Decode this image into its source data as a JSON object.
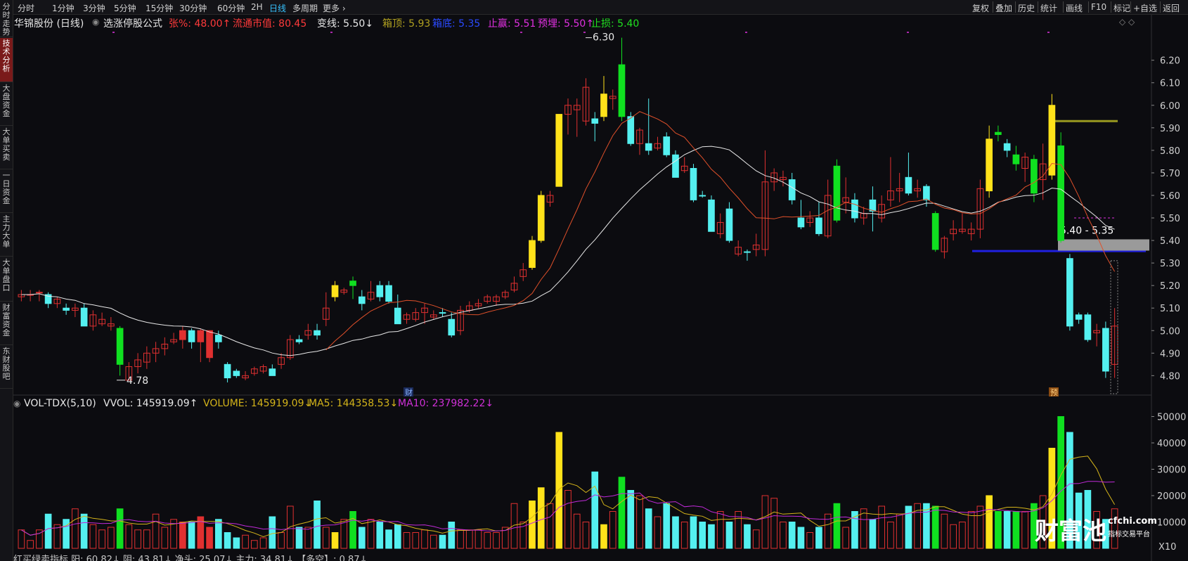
{
  "sidebar": [
    {
      "label": "分时走势",
      "active": false
    },
    {
      "label": "技术分析",
      "active": true
    },
    {
      "label": "大盘资金",
      "active": false
    },
    {
      "label": "大单买卖",
      "active": false
    },
    {
      "label": "一日资金",
      "active": false
    },
    {
      "label": "主力大单",
      "active": false
    },
    {
      "label": "大单盘口",
      "active": false
    },
    {
      "label": "财富资金",
      "active": false
    },
    {
      "label": "东财股吧",
      "active": false
    }
  ],
  "periods": [
    "分时",
    "1分钟",
    "3分钟",
    "5分钟",
    "15分钟",
    "30分钟",
    "60分钟",
    "2H",
    "日线",
    "多周期",
    "更多 ›"
  ],
  "active_period": "日线",
  "tools": [
    "复权",
    "叠加",
    "历史",
    "统计",
    "画线",
    "F10",
    "标记",
    "+自选",
    "返回"
  ],
  "header": {
    "stock": "华锦股份 (日线)",
    "formula": "选涨停股公式",
    "zhang": "张%: 48.00↑",
    "ltsz": "流通市值: 80.45",
    "bianxian": "变线: 5.50↓",
    "xiangding": "箱顶: 5.93",
    "xiangdi": "箱底: 5.35",
    "zhiying": "止赢: 5.51",
    "yumai": "预埋: 5.50↑",
    "zhisun": "止损: 5.40",
    "diamond": "◇ ◇"
  },
  "colors": {
    "up": "#e03030",
    "down": "#54f0f0",
    "yellow_up": "#ffe21a",
    "green_up": "#10e020",
    "ma_slow": "#e8e8e8",
    "ma_fast": "#e0502a",
    "ma5_vol": "#d4b41a",
    "ma10_vol": "#c02ad8",
    "box_top": "#999920",
    "box_bottom": "#2020e0"
  },
  "annotations": {
    "high": "6.30",
    "low": "4.78",
    "range": "5.40 - 5.35",
    "cai": "财",
    "yu": "预"
  },
  "vol_header": {
    "name": "VOL-TDX(5,10)",
    "vvol": "VVOL: 145919.09↑",
    "volume": "VOLUME: 145919.09↓",
    "ma5": "MA5: 144358.53↓",
    "ma10": "MA10: 237982.22↓"
  },
  "vol_unit": "X10",
  "bottom_bar": "红买绿卖指标 阳: 60.82↓ 阴: 43.81↓ 净头: 25.07↓ 主力: 34.81↓ 【多空】: 0.87↓",
  "logo": {
    "brand": "财富池",
    "url": "cfchi.com",
    "tagline": "指标交易平台"
  },
  "chart_data": {
    "type": "candlestick",
    "price_ylim": [
      4.72,
      6.33
    ],
    "price_ticks": [
      4.8,
      4.9,
      5.0,
      5.1,
      5.2,
      5.3,
      5.4,
      5.5,
      5.6,
      5.7,
      5.8,
      5.9,
      6.0,
      6.1,
      6.2
    ],
    "volume_ylim": [
      0,
      52000
    ],
    "volume_ticks": [
      10000,
      20000,
      30000,
      40000,
      50000
    ],
    "grid": false,
    "box_top": 5.93,
    "box_bottom": 5.35,
    "candles": [
      [
        5.15,
        5.16,
        5.13,
        5.18,
        7000,
        "up"
      ],
      [
        5.16,
        5.16,
        5.13,
        5.18,
        3000,
        "up"
      ],
      [
        5.17,
        5.17,
        5.13,
        5.18,
        7000,
        "up"
      ],
      [
        5.16,
        5.12,
        5.1,
        5.17,
        13000,
        "down"
      ],
      [
        5.12,
        5.14,
        5.1,
        5.15,
        9000,
        "up"
      ],
      [
        5.1,
        5.09,
        5.07,
        5.12,
        11000,
        "down"
      ],
      [
        5.09,
        5.1,
        5.06,
        5.12,
        15000,
        "up"
      ],
      [
        5.1,
        5.02,
        5.02,
        5.12,
        13000,
        "down"
      ],
      [
        5.02,
        5.07,
        5.0,
        5.09,
        9000,
        "up"
      ],
      [
        5.05,
        5.03,
        5.02,
        5.08,
        7000,
        "up"
      ],
      [
        5.02,
        5.03,
        5.0,
        5.06,
        8000,
        "up"
      ],
      [
        5.01,
        4.85,
        4.8,
        5.02,
        15000,
        "green"
      ],
      [
        4.78,
        4.84,
        4.78,
        4.86,
        9000,
        "up"
      ],
      [
        4.84,
        4.87,
        4.81,
        4.9,
        7000,
        "up"
      ],
      [
        4.86,
        4.9,
        4.83,
        4.93,
        7000,
        "up"
      ],
      [
        4.9,
        4.92,
        4.86,
        4.95,
        13000,
        "up"
      ],
      [
        4.92,
        4.94,
        4.89,
        4.97,
        8000,
        "up"
      ],
      [
        4.95,
        4.96,
        4.94,
        4.99,
        11000,
        "up"
      ],
      [
        4.96,
        5.0,
        4.92,
        5.02,
        10000,
        "red"
      ],
      [
        5.0,
        4.95,
        4.92,
        5.01,
        10000,
        "down"
      ],
      [
        4.95,
        5.0,
        4.86,
        5.01,
        12000,
        "red"
      ],
      [
        5.0,
        4.88,
        4.86,
        5.0,
        8000,
        "red"
      ],
      [
        4.95,
        4.98,
        4.92,
        5.0,
        11000,
        "down"
      ],
      [
        4.85,
        4.79,
        4.77,
        4.86,
        6000,
        "down"
      ],
      [
        4.82,
        4.8,
        4.79,
        4.83,
        4000,
        "down"
      ],
      [
        4.79,
        4.8,
        4.78,
        4.82,
        5000,
        "up"
      ],
      [
        4.81,
        4.83,
        4.8,
        4.84,
        3000,
        "up"
      ],
      [
        4.82,
        4.84,
        4.81,
        4.85,
        4000,
        "up"
      ],
      [
        4.83,
        4.8,
        4.8,
        4.85,
        12000,
        "down"
      ],
      [
        4.85,
        4.88,
        4.83,
        4.9,
        6000,
        "up"
      ],
      [
        4.88,
        4.96,
        4.87,
        4.98,
        16000,
        "up"
      ],
      [
        4.96,
        4.95,
        4.94,
        4.98,
        8000,
        "down"
      ],
      [
        4.98,
        5.0,
        4.96,
        5.03,
        8000,
        "up"
      ],
      [
        5.0,
        4.98,
        4.96,
        5.03,
        18000,
        "down"
      ],
      [
        5.05,
        5.1,
        5.02,
        5.17,
        8000,
        "up"
      ],
      [
        5.15,
        5.2,
        5.13,
        5.22,
        6000,
        "yellow"
      ],
      [
        5.18,
        5.17,
        5.16,
        5.19,
        11000,
        "up"
      ],
      [
        5.2,
        5.22,
        5.14,
        5.24,
        14000,
        "green"
      ],
      [
        5.15,
        5.12,
        5.09,
        5.18,
        8000,
        "down"
      ],
      [
        5.14,
        5.17,
        5.13,
        5.22,
        11000,
        "up"
      ],
      [
        5.2,
        5.15,
        5.13,
        5.22,
        10000,
        "down"
      ],
      [
        5.2,
        5.13,
        5.12,
        5.22,
        7000,
        "down"
      ],
      [
        5.1,
        5.03,
        5.03,
        5.16,
        9000,
        "down"
      ],
      [
        5.07,
        5.05,
        5.03,
        5.08,
        6000,
        "up"
      ],
      [
        5.05,
        5.08,
        5.04,
        5.1,
        6000,
        "up"
      ],
      [
        5.08,
        5.1,
        5.03,
        5.12,
        7000,
        "up"
      ],
      [
        5.07,
        5.06,
        5.05,
        5.09,
        5000,
        "up"
      ],
      [
        5.08,
        5.08,
        5.06,
        5.1,
        5000,
        "down"
      ],
      [
        5.05,
        4.98,
        4.97,
        5.08,
        10000,
        "down"
      ],
      [
        5.0,
        5.09,
        4.98,
        5.11,
        7000,
        "up"
      ],
      [
        5.09,
        5.11,
        5.08,
        5.13,
        7000,
        "up"
      ],
      [
        5.11,
        5.12,
        5.1,
        5.14,
        7000,
        "up"
      ],
      [
        5.13,
        5.15,
        5.12,
        5.16,
        6000,
        "up"
      ],
      [
        5.13,
        5.15,
        5.11,
        5.16,
        6000,
        "up"
      ],
      [
        5.15,
        5.17,
        5.14,
        5.18,
        8000,
        "up"
      ],
      [
        5.18,
        5.21,
        5.17,
        5.24,
        17000,
        "up"
      ],
      [
        5.24,
        5.27,
        5.22,
        5.3,
        10000,
        "up"
      ],
      [
        5.28,
        5.4,
        5.27,
        5.42,
        18000,
        "yellow"
      ],
      [
        5.4,
        5.6,
        5.39,
        5.62,
        23000,
        "yellow"
      ],
      [
        5.57,
        5.6,
        5.55,
        5.62,
        17000,
        "up"
      ],
      [
        5.64,
        5.96,
        5.64,
        5.96,
        44000,
        "yellow"
      ],
      [
        5.96,
        6.0,
        5.87,
        6.03,
        22000,
        "up"
      ],
      [
        5.98,
        6.0,
        5.86,
        6.03,
        13000,
        "up"
      ],
      [
        5.93,
        6.08,
        5.91,
        6.12,
        10000,
        "up"
      ],
      [
        5.94,
        5.92,
        5.84,
        5.97,
        29000,
        "down"
      ],
      [
        5.95,
        6.05,
        5.93,
        6.13,
        9000,
        "yellow"
      ],
      [
        6.03,
        6.04,
        5.98,
        6.07,
        14000,
        "up"
      ],
      [
        6.18,
        5.95,
        5.93,
        6.3,
        27000,
        "green"
      ],
      [
        5.95,
        5.83,
        5.82,
        5.97,
        22000,
        "down"
      ],
      [
        5.83,
        5.89,
        5.78,
        5.9,
        20000,
        "up"
      ],
      [
        5.83,
        5.8,
        5.78,
        6.03,
        15000,
        "down"
      ],
      [
        5.81,
        5.83,
        5.8,
        5.86,
        12000,
        "up"
      ],
      [
        5.86,
        5.78,
        5.77,
        5.88,
        17000,
        "down"
      ],
      [
        5.78,
        5.68,
        5.68,
        5.8,
        12000,
        "down"
      ],
      [
        5.71,
        5.73,
        5.7,
        5.77,
        10000,
        "up"
      ],
      [
        5.72,
        5.58,
        5.57,
        5.74,
        12000,
        "down"
      ],
      [
        5.6,
        5.6,
        5.59,
        5.62,
        10000,
        "down"
      ],
      [
        5.58,
        5.44,
        5.44,
        5.6,
        9000,
        "down"
      ],
      [
        5.43,
        5.48,
        5.41,
        5.52,
        14000,
        "up"
      ],
      [
        5.54,
        5.4,
        5.39,
        5.57,
        10000,
        "down"
      ],
      [
        5.34,
        5.37,
        5.33,
        5.4,
        14000,
        "up"
      ],
      [
        5.35,
        5.35,
        5.31,
        5.36,
        9000,
        "down"
      ],
      [
        5.36,
        5.38,
        5.33,
        5.43,
        7000,
        "up"
      ],
      [
        5.36,
        5.66,
        5.33,
        5.8,
        20000,
        "up"
      ],
      [
        5.66,
        5.7,
        5.62,
        5.72,
        19000,
        "up"
      ],
      [
        5.67,
        5.68,
        5.64,
        5.71,
        10000,
        "up"
      ],
      [
        5.67,
        5.58,
        5.56,
        5.7,
        10000,
        "down"
      ],
      [
        5.5,
        5.46,
        5.45,
        5.58,
        8000,
        "down"
      ],
      [
        5.48,
        5.5,
        5.46,
        5.53,
        6000,
        "up"
      ],
      [
        5.5,
        5.43,
        5.42,
        5.57,
        8000,
        "down"
      ],
      [
        5.42,
        5.6,
        5.41,
        5.67,
        13000,
        "up"
      ],
      [
        5.73,
        5.49,
        5.48,
        5.76,
        17000,
        "green"
      ],
      [
        5.57,
        5.59,
        5.52,
        5.68,
        8000,
        "up"
      ],
      [
        5.5,
        5.58,
        5.48,
        5.61,
        14000,
        "down"
      ],
      [
        5.5,
        5.52,
        5.47,
        5.55,
        15000,
        "up"
      ],
      [
        5.53,
        5.58,
        5.44,
        5.64,
        11000,
        "down"
      ],
      [
        5.56,
        5.5,
        5.48,
        5.6,
        16000,
        "up"
      ],
      [
        5.58,
        5.62,
        5.55,
        5.77,
        10000,
        "up"
      ],
      [
        5.62,
        5.63,
        5.57,
        5.7,
        13000,
        "up"
      ],
      [
        5.68,
        5.61,
        5.6,
        5.79,
        16000,
        "down"
      ],
      [
        5.62,
        5.63,
        5.59,
        5.67,
        17000,
        "up"
      ],
      [
        5.64,
        5.58,
        5.55,
        5.65,
        17000,
        "down"
      ],
      [
        5.52,
        5.36,
        5.35,
        5.53,
        16000,
        "green"
      ],
      [
        5.35,
        5.41,
        5.32,
        5.42,
        13000,
        "up"
      ],
      [
        5.43,
        5.45,
        5.4,
        5.49,
        9000,
        "up"
      ],
      [
        5.45,
        5.44,
        5.43,
        5.52,
        10000,
        "up"
      ],
      [
        5.43,
        5.45,
        5.4,
        5.48,
        14000,
        "up"
      ],
      [
        5.45,
        5.63,
        5.41,
        5.67,
        16000,
        "up"
      ],
      [
        5.62,
        5.85,
        5.59,
        5.91,
        20000,
        "yellow"
      ],
      [
        5.87,
        5.88,
        5.84,
        5.91,
        14000,
        "green"
      ],
      [
        5.83,
        5.8,
        5.77,
        5.85,
        14000,
        "down"
      ],
      [
        5.78,
        5.74,
        5.71,
        5.82,
        14000,
        "green"
      ],
      [
        5.77,
        5.72,
        5.66,
        5.79,
        14000,
        "up"
      ],
      [
        5.76,
        5.61,
        5.57,
        5.78,
        17000,
        "green"
      ],
      [
        5.67,
        5.74,
        5.58,
        5.83,
        20000,
        "up"
      ],
      [
        5.69,
        6.0,
        5.67,
        6.05,
        38000,
        "yellow"
      ],
      [
        5.82,
        5.4,
        5.39,
        5.88,
        50000,
        "green"
      ],
      [
        5.32,
        5.02,
        5.0,
        5.34,
        44000,
        "down"
      ],
      [
        5.07,
        5.05,
        5.03,
        5.08,
        21000,
        "down"
      ],
      [
        5.07,
        4.96,
        4.95,
        5.08,
        22000,
        "down"
      ],
      [
        4.99,
        5.0,
        4.93,
        5.03,
        14000,
        "up"
      ],
      [
        5.01,
        4.82,
        4.79,
        5.04,
        11000,
        "down"
      ],
      [
        4.85,
        5.02,
        4.79,
        5.1,
        15000,
        "up"
      ]
    ]
  }
}
